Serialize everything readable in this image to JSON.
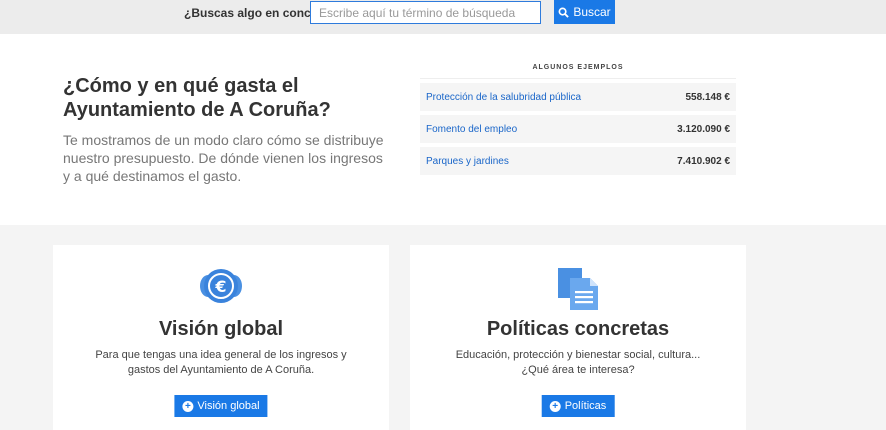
{
  "search": {
    "question": "¿Buscas algo en concreto?",
    "placeholder": "Escribe aquí tu término de búsqueda",
    "button_label": "Buscar"
  },
  "intro": {
    "title": "¿Cómo y en qué gasta el Ayuntamiento de A Coruña?",
    "text": "Te mostramos de un modo claro cómo se distribuye nuestro presupuesto. De dónde vienen los ingresos y a qué destinamos el gasto."
  },
  "examples": {
    "title": "ALGUNOS EJEMPLOS",
    "items": [
      {
        "name": "Protección de la salubridad pública",
        "value": "558.148 €"
      },
      {
        "name": "Fomento del empleo",
        "value": "3.120.090 €"
      },
      {
        "name": "Parques y jardines",
        "value": "7.410.902 €"
      }
    ]
  },
  "cards": [
    {
      "icon": "euro-coins-icon",
      "title": "Visión global",
      "text": "Para que tengas una idea general de los ingresos y gastos del Ayuntamiento de A Coruña.",
      "button_label": "Visión global"
    },
    {
      "icon": "documents-icon",
      "title": "Políticas concretas",
      "text": "Educación, protección y bienestar social, cultura... ¿Qué área te interesa?",
      "button_label": "Políticas"
    }
  ],
  "colors": {
    "accent": "#1a79e6",
    "link": "#1a66c9",
    "icon_blue": "#4a90e2"
  }
}
